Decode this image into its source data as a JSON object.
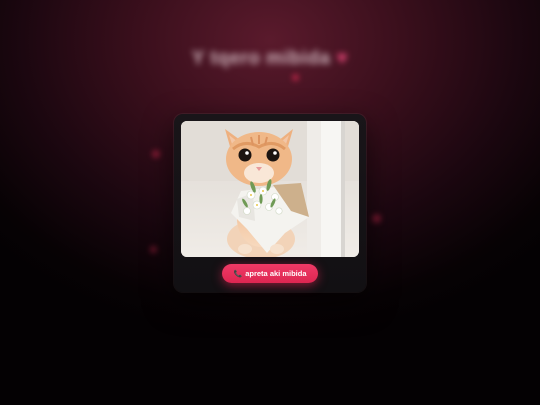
{
  "page": {
    "background_title": "Y tqero mibida",
    "background_heart_icon": "heart-icon"
  },
  "card": {
    "image_alt": "kitten holding a flower bouquet",
    "cta_icon": "phone-icon",
    "cta_label": "apreta aki mibida"
  },
  "colors": {
    "accent": "#ee3461",
    "background_glow": "#5a1a2c",
    "card_bg": "#161216"
  }
}
